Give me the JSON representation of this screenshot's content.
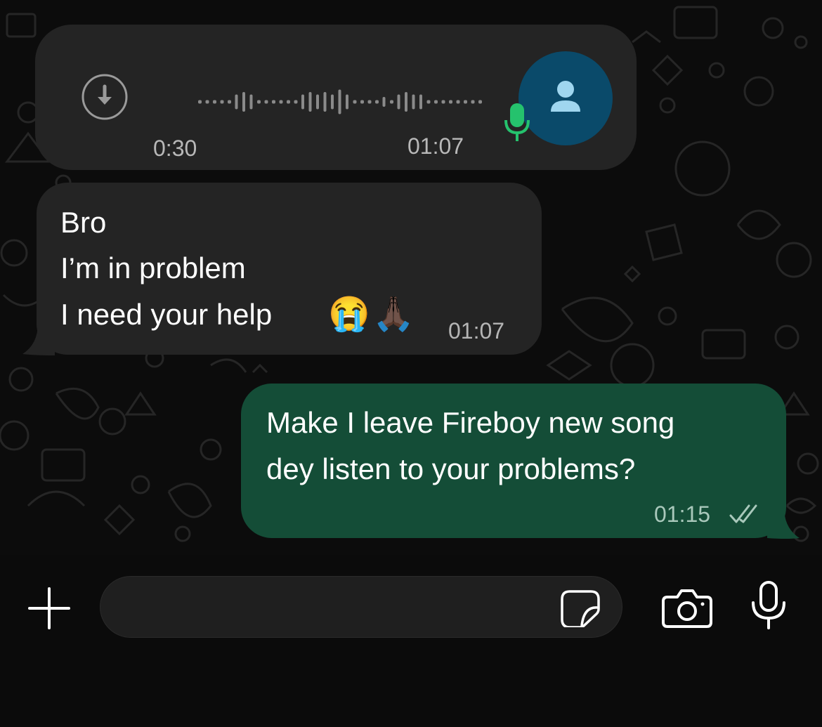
{
  "conversation": {
    "voice_message": {
      "elapsed": "0:30",
      "time": "01:07",
      "download_icon": "download-arrow-icon",
      "avatar_icon": "person-icon",
      "mic_icon": "microphone-icon",
      "colors": {
        "mic": "#25c26d",
        "avatar_bg": "#0a4a6a"
      }
    },
    "incoming_message": {
      "lines": [
        "Bro",
        "I’m in problem",
        "I need your help"
      ],
      "emojis": [
        "😭",
        "🙏🏿"
      ],
      "time": "01:07"
    },
    "outgoing_message": {
      "lines": [
        "Make I leave Fireboy new song",
        "dey listen to your problems?"
      ],
      "time": "01:15",
      "status_icon": "double-check-icon"
    }
  },
  "input_bar": {
    "input_value": "",
    "icons": [
      "plus-icon",
      "sticker-icon",
      "camera-icon",
      "microphone-icon"
    ]
  },
  "colors": {
    "incoming_bubble": "#242424",
    "outgoing_bubble": "#144d37",
    "background": "#0b0b0b"
  }
}
